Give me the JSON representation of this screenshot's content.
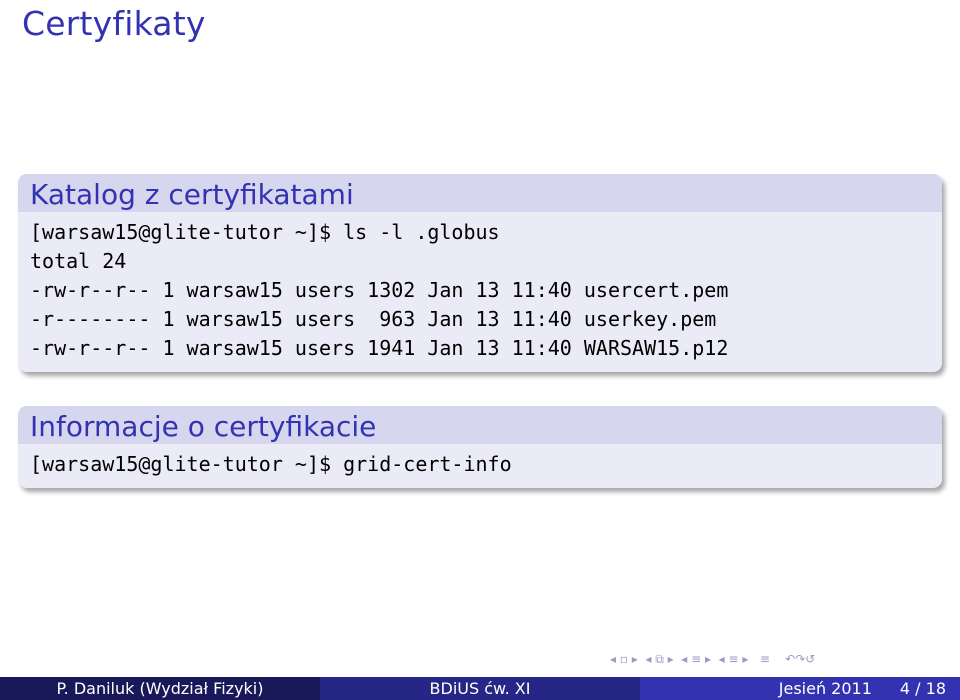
{
  "slide": {
    "title": "Certyfikaty"
  },
  "blocks": [
    {
      "heading": "Katalog z certyfikatami",
      "lines": [
        "[warsaw15@glite-tutor ~]$ ls -l .globus",
        "total 24",
        "-rw-r--r-- 1 warsaw15 users 1302 Jan 13 11:40 usercert.pem",
        "-r-------- 1 warsaw15 users  963 Jan 13 11:40 userkey.pem",
        "-rw-r--r-- 1 warsaw15 users 1941 Jan 13 11:40 WARSAW15.p12"
      ]
    },
    {
      "heading": "Informacje o certyfikacie",
      "lines": [
        "[warsaw15@glite-tutor ~]$ grid-cert-info"
      ]
    }
  ],
  "navigation": {
    "symbols": "◂ ▫ ▸  ◂ ⧉ ▸  ◂ ≡ ▸  ◂ ≡ ▸   ≡    ↶↷↺"
  },
  "footer": {
    "author": "P. Daniluk  (Wydział Fizyki)",
    "short_title": "BDiUS ćw. XI",
    "date": "Jesień 2011",
    "page": "4 / 18"
  },
  "colors": {
    "title": "#3333b2",
    "block_header_bg": "#d6d6ef",
    "block_body_bg": "#ebebf7",
    "footer_left": "#191959",
    "footer_mid": "#262686",
    "footer_right": "#3333b2"
  }
}
